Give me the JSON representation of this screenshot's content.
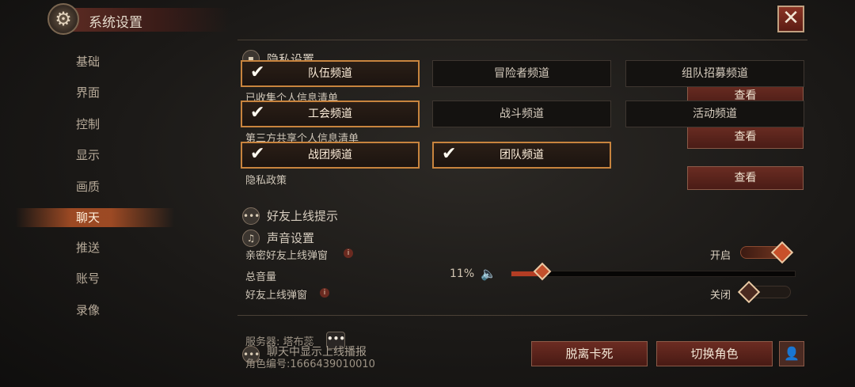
{
  "window": {
    "title": "系统设置",
    "close_label": "✕"
  },
  "sidebar": {
    "items": [
      {
        "label": "基础",
        "active": false
      },
      {
        "label": "界面",
        "active": false
      },
      {
        "label": "控制",
        "active": false
      },
      {
        "label": "显示",
        "active": false
      },
      {
        "label": "画质",
        "active": false
      },
      {
        "label": "聊天",
        "active": true
      },
      {
        "label": "推送",
        "active": false
      },
      {
        "label": "账号",
        "active": false
      },
      {
        "label": "录像",
        "active": false
      }
    ]
  },
  "privacy": {
    "title": "隐私设置",
    "rows": [
      {
        "label": "已收集个人信息清单",
        "button": "查看"
      },
      {
        "label": "第三方共享个人信息清单",
        "button": "查看"
      },
      {
        "label": "隐私政策",
        "button": "查看"
      }
    ]
  },
  "channels": [
    {
      "label": "队伍频道",
      "checked": true
    },
    {
      "label": "冒险者频道",
      "checked": false
    },
    {
      "label": "组队招募频道",
      "checked": false
    },
    {
      "label": "工会频道",
      "checked": true
    },
    {
      "label": "战斗频道",
      "checked": false
    },
    {
      "label": "活动频道",
      "checked": false
    },
    {
      "label": "战团频道",
      "checked": true
    },
    {
      "label": "团队频道",
      "checked": true
    }
  ],
  "friend_online": {
    "title": "好友上线提示",
    "close_friend_popup_label": "亲密好友上线弹窗",
    "close_friend_popup_state": "开启",
    "friend_popup_label": "好友上线弹窗",
    "friend_popup_state": "关闭"
  },
  "sound": {
    "title": "声音设置",
    "master_label": "总音量",
    "master_value": "11%",
    "master_fraction": 0.11
  },
  "footer": {
    "server": "服务器: 塔布蕊",
    "role_id": "角色编号:1666439010010",
    "chat_show_title": "聊天中显示上线播报",
    "dots": "•••",
    "unstuck_button": "脱离卡死",
    "switch_role_button": "切换角色"
  },
  "colors": {
    "accent": "#c8843e",
    "button": "#6a2c22",
    "active_tab": "#c85a28"
  }
}
